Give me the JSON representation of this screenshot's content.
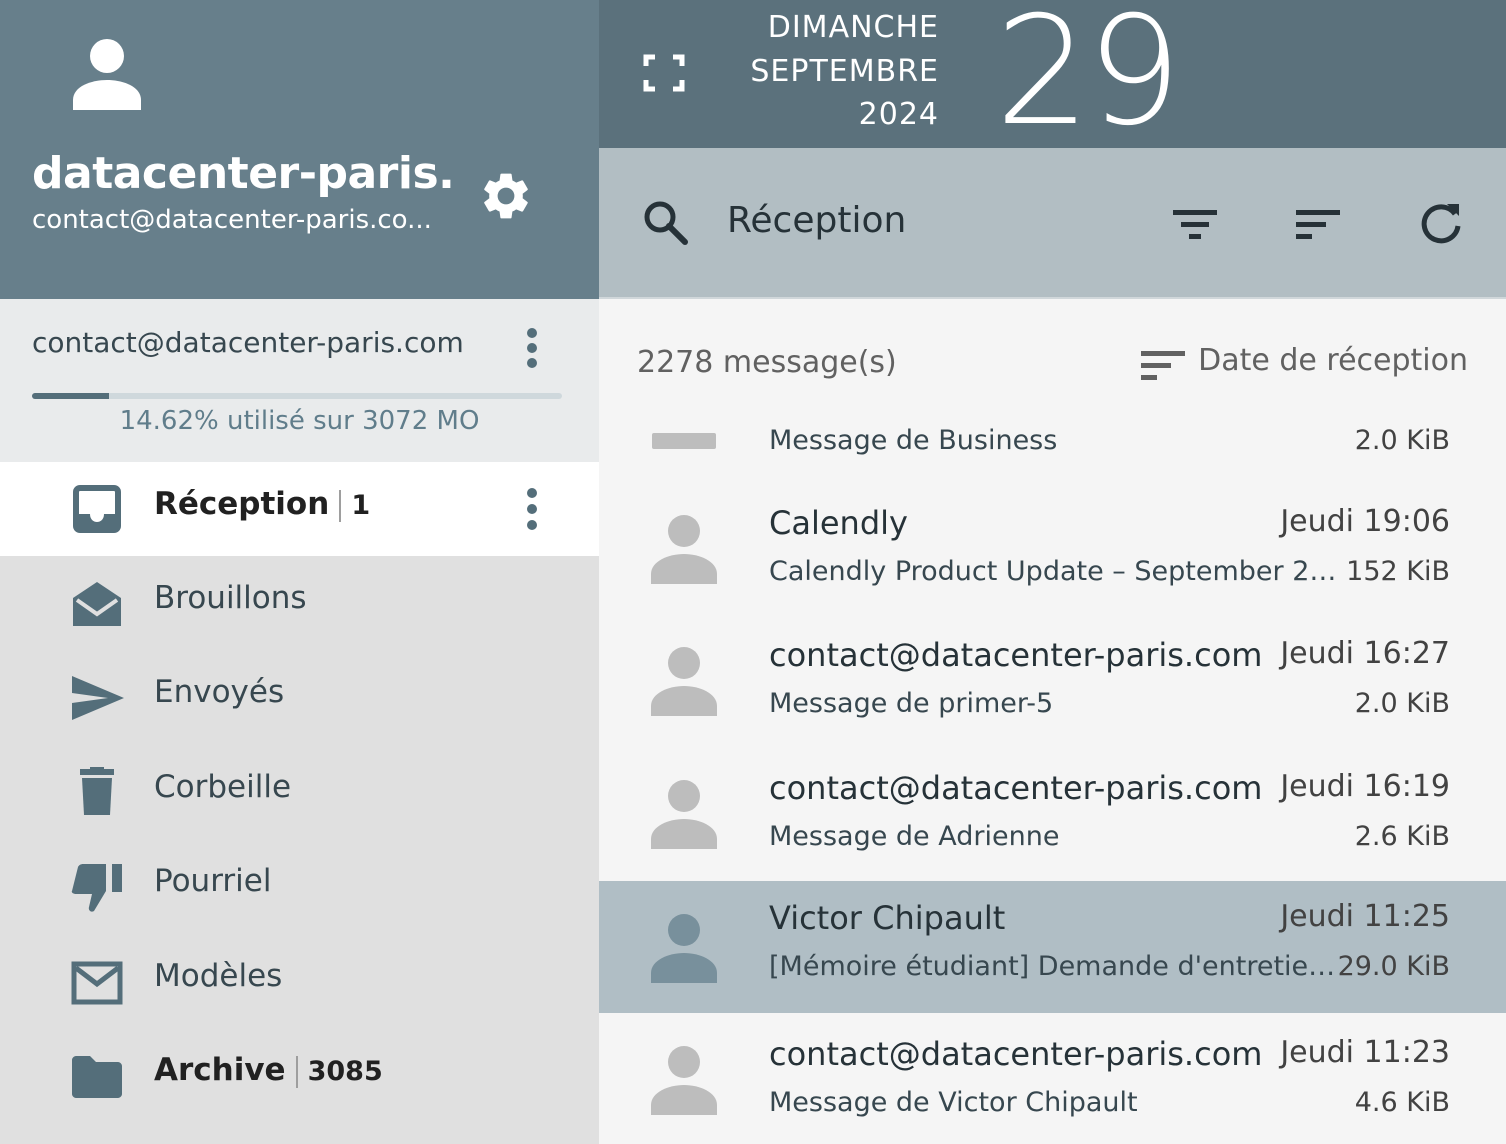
{
  "profile": {
    "name": "datacenter-paris....",
    "email": "contact@datacenter-paris.co..."
  },
  "account": {
    "email": "contact@datacenter-paris.com",
    "quota_text": "14.62% utilisé sur 3072 MO",
    "quota_percent": 14.62
  },
  "folders": [
    {
      "name": "Réception",
      "count": "1",
      "active": true
    },
    {
      "name": "Brouillons"
    },
    {
      "name": "Envoyés"
    },
    {
      "name": "Corbeille"
    },
    {
      "name": "Pourriel"
    },
    {
      "name": "Modèles"
    },
    {
      "name": "Archive",
      "count": "3085"
    }
  ],
  "date": {
    "weekday": "DIMANCHE",
    "month": "SEPTEMBRE",
    "year": "2024",
    "day": "29"
  },
  "toolbar": {
    "title": "Réception"
  },
  "list": {
    "count": "2278 message(s)",
    "sort_label": "Date de réception"
  },
  "messages": [
    {
      "sender": "",
      "time": "",
      "subject": "Message de Business",
      "size": "2.0 KiB"
    },
    {
      "sender": "Calendly",
      "time": "Jeudi 19:06",
      "subject": "Calendly Product Update – September 2024",
      "size": "152 KiB"
    },
    {
      "sender": "contact@datacenter-paris.com",
      "time": "Jeudi 16:27",
      "subject": "Message de primer-5",
      "size": "2.0 KiB"
    },
    {
      "sender": "contact@datacenter-paris.com",
      "time": "Jeudi 16:19",
      "subject": "Message de Adrienne",
      "size": "2.6 KiB"
    },
    {
      "sender": "Victor Chipault",
      "time": "Jeudi 11:25",
      "subject": "[Mémoire étudiant] Demande d'entretien ...",
      "size": "29.0 KiB",
      "selected": true
    },
    {
      "sender": "contact@datacenter-paris.com",
      "time": "Jeudi 11:23",
      "subject": "Message de Victor Chipault",
      "size": "4.6 KiB"
    }
  ],
  "colors": {
    "profile_bg": "#677f8b",
    "datebar_bg": "#5b717c",
    "searchbar_bg": "#b2bec3",
    "selected_row": "#b0bec5",
    "sidebar_bg": "#e0e0e0"
  }
}
